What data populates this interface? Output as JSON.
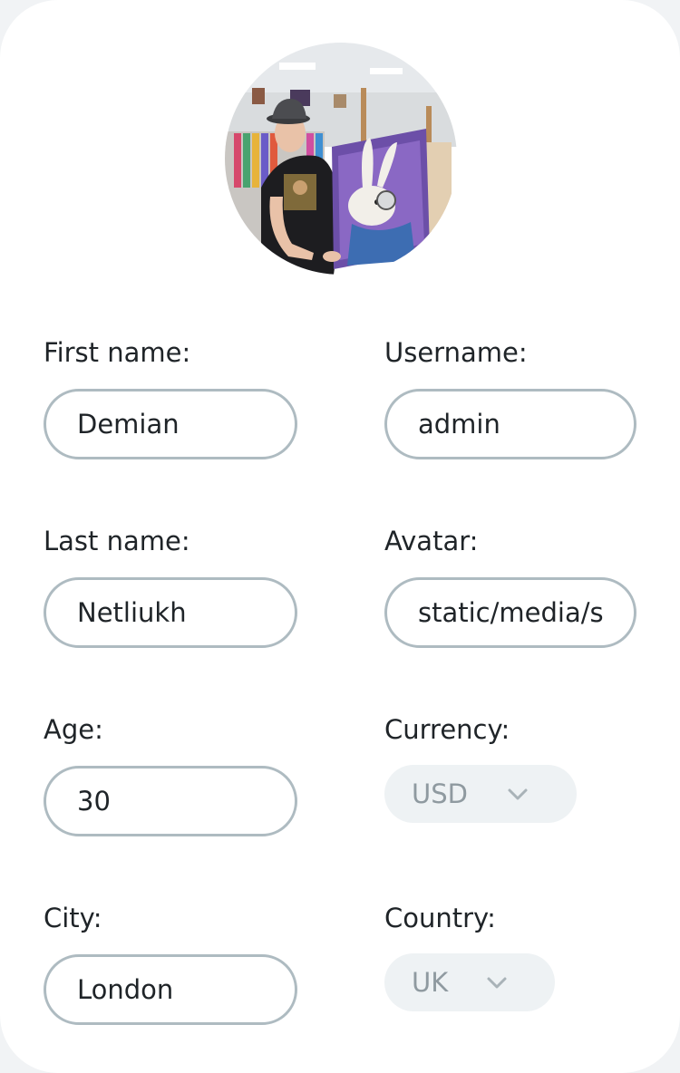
{
  "profile": {
    "avatar_icon": "user-photo"
  },
  "form": {
    "first_name": {
      "label": "First name:",
      "value": "Demian"
    },
    "username": {
      "label": "Username:",
      "value": "admin"
    },
    "last_name": {
      "label": "Last name:",
      "value": "Netliukh"
    },
    "avatar": {
      "label": "Avatar:",
      "value": "static/media/sr"
    },
    "age": {
      "label": "Age:",
      "value": "30"
    },
    "currency": {
      "label": "Currency:",
      "value": "USD",
      "icon": "chevron-down-icon"
    },
    "city": {
      "label": "City:",
      "value": "London"
    },
    "country": {
      "label": "Country:",
      "value": "UK",
      "icon": "chevron-down-icon"
    }
  },
  "colors": {
    "field_border": "#aebbc1",
    "select_bg": "#eef2f4",
    "select_text": "#8f9aa0",
    "text": "#1f2428"
  }
}
